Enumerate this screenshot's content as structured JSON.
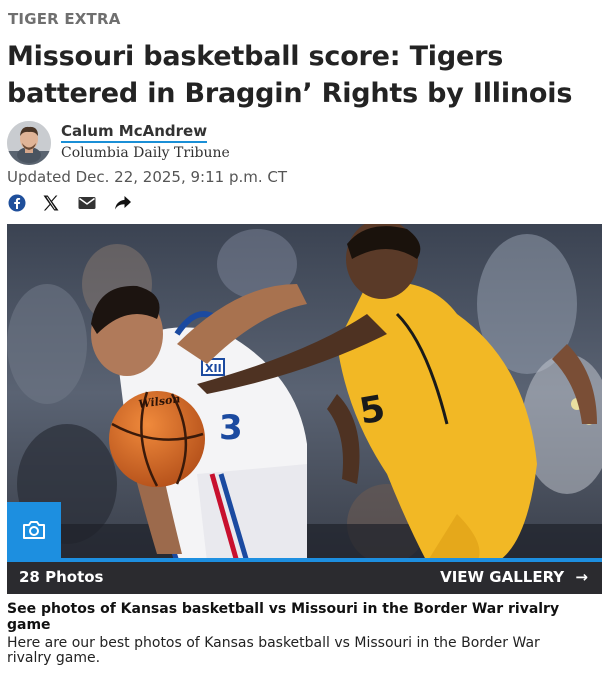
{
  "section_label": "TIGER EXTRA",
  "headline": "Missouri basketball score: Tigers battered in Braggin’ Rights by Illinois",
  "byline": {
    "author": "Calum McAndrew",
    "publication": "Columbia Daily Tribune",
    "updated": "Updated Dec. 22, 2025, 9:11 p.m. CT"
  },
  "share_icons": [
    "facebook-icon",
    "x-icon",
    "email-icon",
    "share-arrow-icon"
  ],
  "gallery": {
    "photo_count": "28 Photos",
    "view_label": "VIEW GALLERY",
    "view_arrow": "→",
    "caption_title": "See photos of Kansas basketball vs Missouri in the Border War rivalry game",
    "caption_body": "Here are our best photos of Kansas basketball vs Missouri in the Border War rivalry game."
  },
  "photo_text": {
    "jersey_number_left": "3",
    "jersey_number_right": "5",
    "conference_patch": "XII",
    "ball_brand": "Wilson"
  },
  "colors": {
    "accent_blue": "#1d8fe0",
    "kansas_blue": "#1b4aa0",
    "mizzou_gold": "#f2b825",
    "bar_dark": "#2b2b2f"
  }
}
